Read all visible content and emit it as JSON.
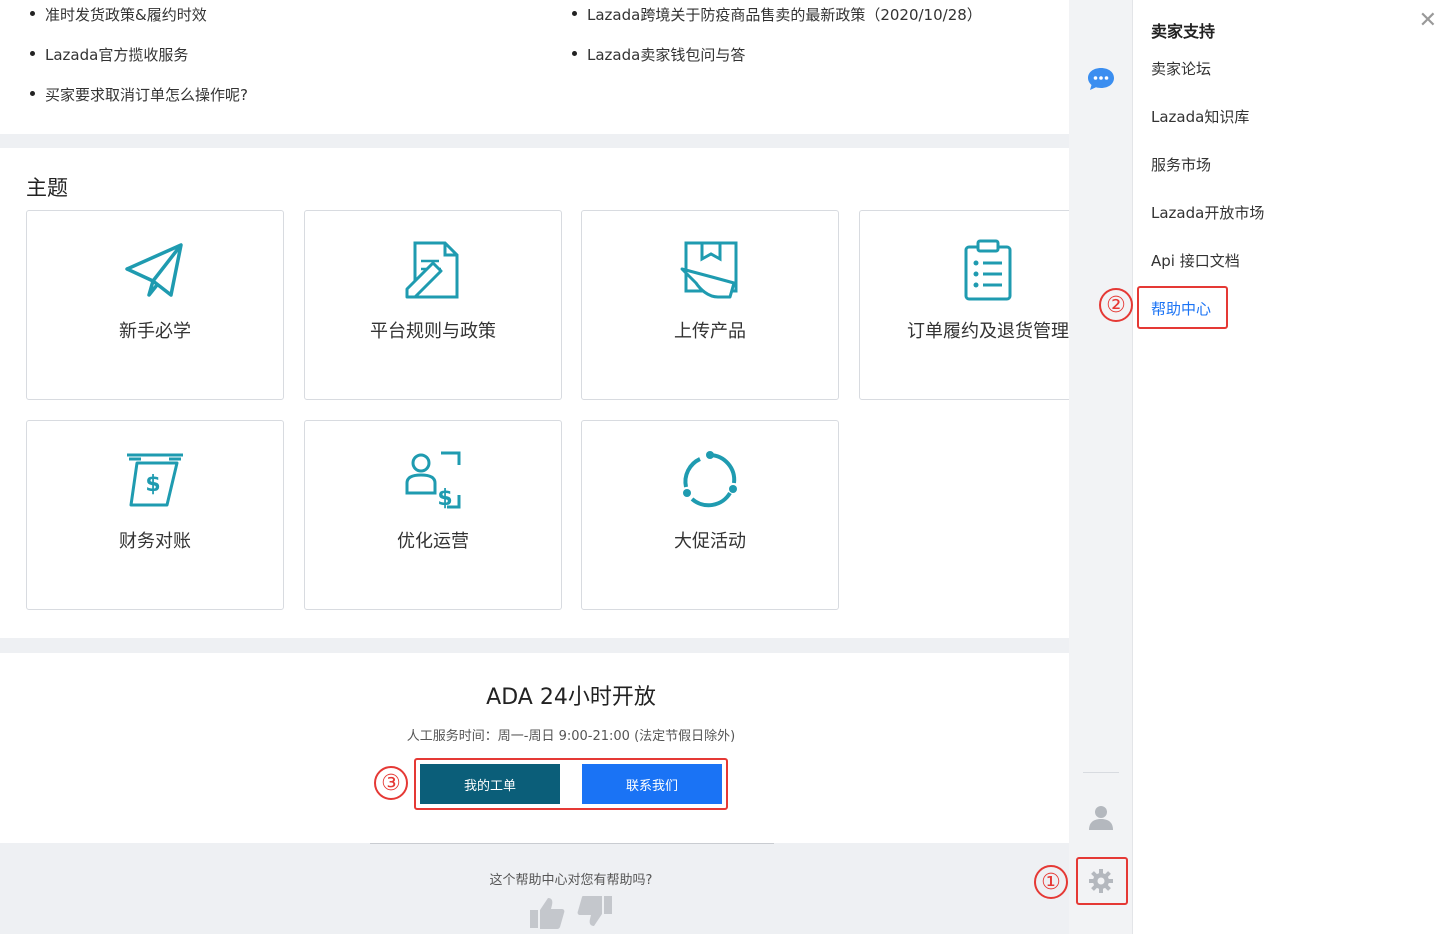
{
  "top_links": [
    "准时发货政策&履约时效",
    "Lazada跨境关于防疫商品售卖的最新政策（2020/10/28）",
    "Lazada官方揽收服务",
    "Lazada卖家钱包问与答",
    "买家要求取消订单怎么操作呢?"
  ],
  "topics": {
    "title": "主题",
    "cards": [
      {
        "label": "新手必学",
        "icon": "paper-plane-icon"
      },
      {
        "label": "平台规则与政策",
        "icon": "document-pen-icon"
      },
      {
        "label": "上传产品",
        "icon": "box-hand-icon"
      },
      {
        "label": "订单履约及退货管理",
        "icon": "clipboard-list-icon"
      },
      {
        "label": "财务对账",
        "icon": "money-bill-icon"
      },
      {
        "label": "优化运营",
        "icon": "user-dollar-icon"
      },
      {
        "label": "大促活动",
        "icon": "cycle-icon"
      }
    ]
  },
  "ada": {
    "title": "ADA 24小时开放",
    "hours": "人工服务时间：周一-周日 9:00-21:00 (法定节假日除外)",
    "my_ticket": "我的工单",
    "contact_us": "联系我们"
  },
  "footer": {
    "question": "这个帮助中心对您有帮助吗?"
  },
  "drawer": {
    "title": "卖家支持",
    "items": [
      "卖家论坛",
      "Lazada知识库",
      "服务市场",
      "Lazada开放市场",
      "Api 接口文档",
      "帮助中心"
    ],
    "active_index": 5
  },
  "annotations": [
    "①",
    "②",
    "③"
  ],
  "colors": {
    "icon_teal": "#1f9bb0",
    "primary_blue": "#1a73f5",
    "ticket_dark": "#0b5e79",
    "annotation_red": "#e53935"
  }
}
